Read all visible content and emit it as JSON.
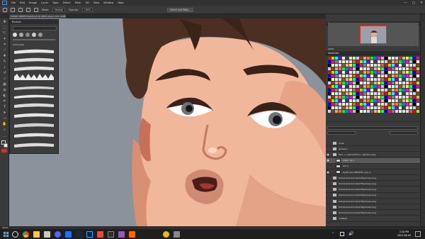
{
  "app": {
    "menu": [
      "File",
      "Edit",
      "Image",
      "Layer",
      "Type",
      "Select",
      "Filter",
      "3D",
      "View",
      "Window",
      "Help"
    ],
    "logo": "Ps"
  },
  "window_controls": [
    "—",
    "□",
    "✕"
  ],
  "options_bar": {
    "mode_label": "Mode:",
    "mode_value": "Normal",
    "opacity_label": "Opacity:",
    "opacity_value": "100%",
    "button": "Select and Mask..."
  },
  "document_tab": "CHASE ANIME EAGLE.psd @ 469% (layer 19.1, RGB/8)",
  "brush_panel": {
    "title": "Brushes",
    "folder": "Airbrushes"
  },
  "panels": {
    "navigator": "Navigator",
    "swatches": "Swatches",
    "layers": "Layers",
    "zoom": "469%"
  },
  "layers": [
    {
      "name": "pride",
      "folder": true,
      "eye": false
    },
    {
      "name": "jameson",
      "folder": true,
      "eye": false
    },
    {
      "name": "fact.../.../james/d3 (v.../jameso.png",
      "folder": true,
      "eye": true
    },
    {
      "name": "Layer 19.1",
      "folder": false,
      "eye": true,
      "selected": true
    },
    {
      "name": "Ctrl A",
      "folder": false,
      "eye": false
    },
    {
      "name": "Eyebrows CERTAIN copy 4",
      "folder": false,
      "eye": true
    },
    {
      "name": "fact/amod/remo/fail/d3/jameso.png",
      "folder": true,
      "eye": false
    },
    {
      "name": "fact/amod/remo/fail/d3/jameso.png",
      "folder": true,
      "eye": false
    },
    {
      "name": "fact/amod/remo/fail/d3/jameso.png",
      "folder": true,
      "eye": false
    },
    {
      "name": "fact/amod/remo/fail/d3/jameso.png",
      "folder": true,
      "eye": false
    },
    {
      "name": "fact/amod/remo/fail/d3/jameso.png",
      "folder": true,
      "eye": false
    },
    {
      "name": "fact/amod/remo/fail/d3/jameso.png",
      "folder": true,
      "eye": false
    },
    {
      "name": "fact/amod/remo/fail/d3/jameso.png",
      "folder": true,
      "eye": false
    },
    {
      "name": "unflated",
      "folder": true,
      "eye": false
    }
  ],
  "status_bar": "469%",
  "taskbar": {
    "time": "2:10 PM",
    "date": "2023-08-03"
  },
  "colors": {
    "accent": "#31a8ff",
    "layer_selected": "#5a5a5a",
    "canvas_bg": "#8c929c"
  }
}
